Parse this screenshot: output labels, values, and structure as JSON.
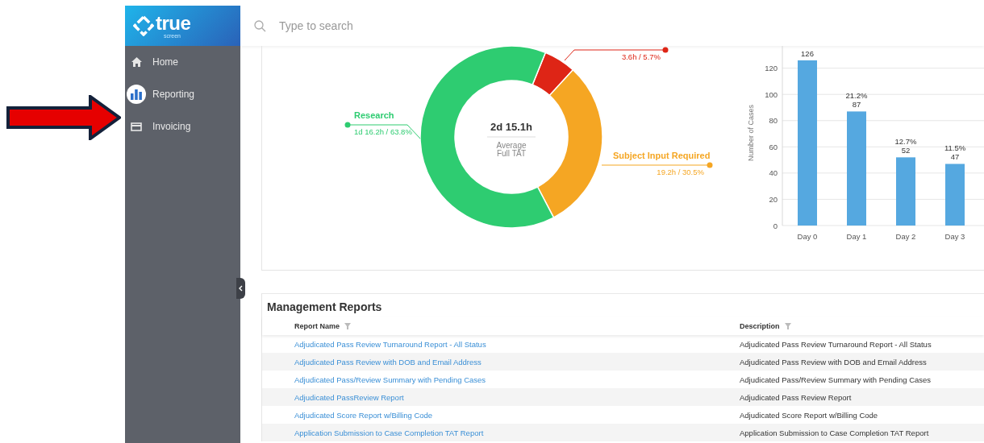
{
  "sidebar": {
    "logo": {
      "word": "true",
      "subword": "screen"
    },
    "items": [
      {
        "label": "Home",
        "selected": false
      },
      {
        "label": "Reporting",
        "selected": true
      },
      {
        "label": "Invoicing",
        "selected": false
      }
    ]
  },
  "search": {
    "placeholder": "Type to search"
  },
  "donut": {
    "center_value": "2d 15.1h",
    "center_label": [
      "Average",
      "Full TAT"
    ],
    "slices": [
      {
        "reading": "3.6h / 5.7%",
        "color": "#de2516"
      },
      {
        "label": "Subject Input Required",
        "reading": "19.2h / 30.5%",
        "color": "#f5a623"
      },
      {
        "label": "Research",
        "reading": "1d 16.2h / 63.8%",
        "color": "#2ecc71"
      }
    ],
    "chart_data": {
      "type": "donut",
      "values": [
        5.7,
        30.5,
        63.8
      ]
    }
  },
  "bar_chart": {
    "chart_data": {
      "type": "bar",
      "ylabel": "Number of Cases",
      "categories": [
        "Day 0",
        "Day 1",
        "Day 2",
        "Day 3"
      ],
      "values": [
        126,
        87,
        52,
        47
      ],
      "ylim": [
        0,
        137
      ],
      "grid": true,
      "yticks": [
        0,
        20,
        40,
        60,
        80,
        100,
        120
      ],
      "value_labels": [
        "126",
        "87",
        "52",
        "47"
      ]
    },
    "percent_labels": [
      "21.2%",
      "12.7%",
      "11.5%"
    ]
  },
  "reports": {
    "title": "Management Reports",
    "columns": [
      "Report Name",
      "Description"
    ],
    "rows": [
      {
        "name": "Adjudicated Pass Review Turnaround Report - All Status",
        "description": "Adjudicated Pass Review Turnaround Report - All Status"
      },
      {
        "name": "Adjudicated Pass Review with DOB and Email Address",
        "description": "Adjudicated Pass Review with DOB and Email Address"
      },
      {
        "name": "Adjudicated Pass/Review Summary with Pending Cases",
        "description": "Adjudicated Pass/Review Summary with Pending Cases"
      },
      {
        "name": "Adjudicated PassReview Report",
        "description": "Adjudicated Pass Review Report"
      },
      {
        "name": "Adjudicated Score Report w/Billing Code",
        "description": "Adjudicated Score Report w/Billing Code"
      },
      {
        "name": "Application Submission to Case Completion TAT Report",
        "description": "Application Submission to Case Completion TAT Report"
      }
    ]
  }
}
